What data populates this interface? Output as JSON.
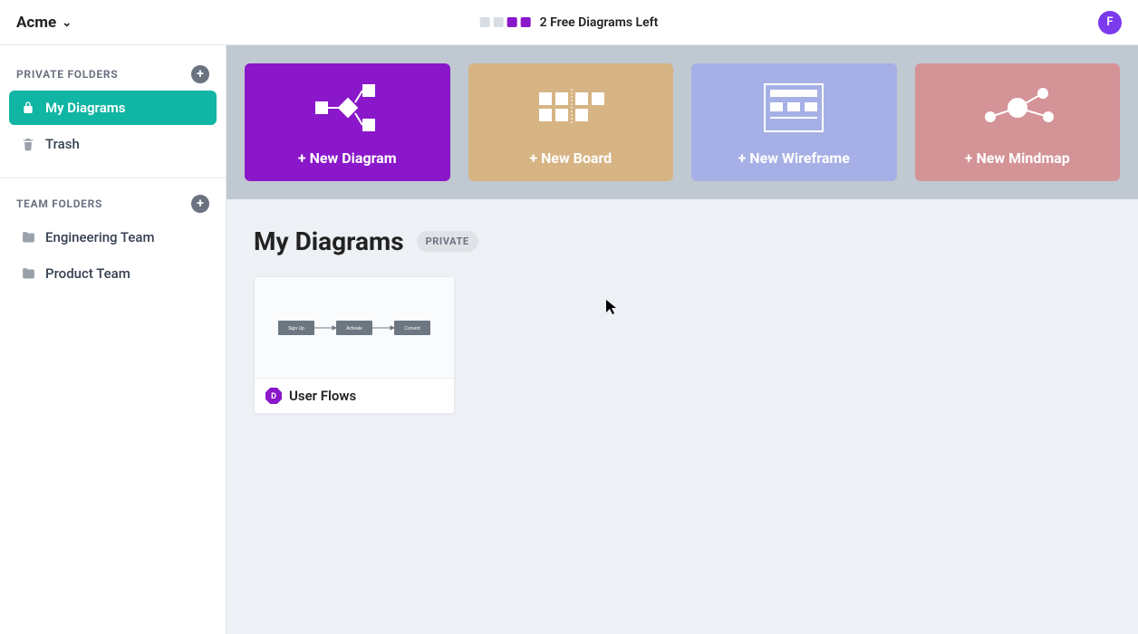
{
  "header": {
    "org_name": "Acme",
    "usage": {
      "used": 2,
      "remaining": 2,
      "label": "2 Free Diagrams Left"
    },
    "avatar_initial": "F"
  },
  "sidebar": {
    "private_section": {
      "title": "PRIVATE FOLDERS",
      "items": [
        {
          "id": "my-diagrams",
          "label": "My Diagrams",
          "icon": "lock-icon",
          "active": true
        },
        {
          "id": "trash",
          "label": "Trash",
          "icon": "trash-icon",
          "active": false
        }
      ]
    },
    "team_section": {
      "title": "TEAM FOLDERS",
      "items": [
        {
          "id": "engineering",
          "label": "Engineering Team",
          "icon": "folder-icon"
        },
        {
          "id": "product",
          "label": "Product Team",
          "icon": "folder-icon"
        }
      ]
    }
  },
  "create_cards": {
    "diagram": {
      "label": "+ New Diagram"
    },
    "board": {
      "label": "+ New Board"
    },
    "wireframe": {
      "label": "+ New Wireframe"
    },
    "mindmap": {
      "label": "+ New Mindmap"
    }
  },
  "page": {
    "title": "My Diagrams",
    "visibility_badge": "PRIVATE"
  },
  "documents": [
    {
      "id": "user-flows",
      "title": "User Flows",
      "type": "diagram",
      "thumb_steps": [
        "Sign Up",
        "Activate",
        "Convert"
      ]
    }
  ],
  "colors": {
    "accent_teal": "#11b5a3",
    "accent_purple": "#8a17c9",
    "card_board": "#d6b483",
    "card_wireframe": "#a6b0e6",
    "card_mindmap": "#d49397"
  }
}
